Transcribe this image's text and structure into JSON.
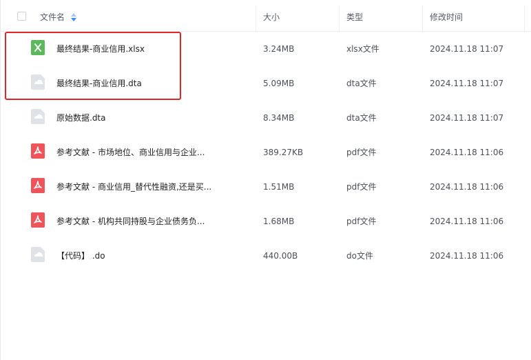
{
  "header": {
    "col_name": "文件名",
    "col_size": "大小",
    "col_type": "类型",
    "col_modified": "修改时间"
  },
  "files": [
    {
      "name": "最终结果-商业信用.xlsx",
      "size": "3.24MB",
      "type": "xlsx文件",
      "modified": "2024.11.18 11:07",
      "icon": "excel-icon"
    },
    {
      "name": "最终结果-商业信用.dta",
      "size": "5.09MB",
      "type": "dta文件",
      "modified": "2024.11.18 11:07",
      "icon": "generic-file-icon"
    },
    {
      "name": "原始数据.dta",
      "size": "8.34MB",
      "type": "dta文件",
      "modified": "2024.11.18 11:07",
      "icon": "generic-file-icon"
    },
    {
      "name": "参考文献 - 市场地位、商业信用与企业...",
      "size": "389.27KB",
      "type": "pdf文件",
      "modified": "2024.11.18 11:06",
      "icon": "pdf-icon"
    },
    {
      "name": "参考文献 - 商业信用_替代性融资,还是买...",
      "size": "1.51MB",
      "type": "pdf文件",
      "modified": "2024.11.18 11:06",
      "icon": "pdf-icon"
    },
    {
      "name": "参考文献 - 机构共同持股与企业债务负...",
      "size": "1.68MB",
      "type": "pdf文件",
      "modified": "2024.11.18 11:06",
      "icon": "pdf-icon"
    },
    {
      "name": "【代码】 .do",
      "size": "440.00B",
      "type": "do文件",
      "modified": "2024.11.18 11:06",
      "icon": "generic-file-icon"
    }
  ],
  "colors": {
    "excel": "#5cb85c",
    "pdf": "#f0545b",
    "generic": "#d7dbe0",
    "highlight": "#e0252b",
    "sort_arrow": "#3b8ef5"
  }
}
